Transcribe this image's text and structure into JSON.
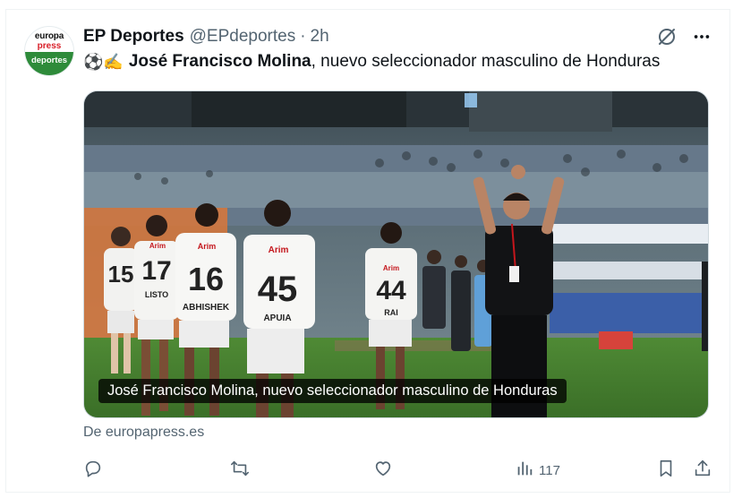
{
  "tweet": {
    "author_name": "EP Deportes",
    "handle": "@EPdeportes",
    "separator": "·",
    "time": "2h",
    "emojis": "⚽✍️",
    "text_bold": "José Francisco Molina",
    "text_rest": ", nuevo seleccionador masculino de Honduras",
    "media_caption": "José Francisco Molina, nuevo seleccionador masculino de Honduras",
    "source": "De europapress.es",
    "views": "117"
  },
  "avatar": {
    "line1": "europa",
    "line2": "press",
    "line3": "deportes"
  },
  "photo": {
    "jerseys": [
      {
        "number": "15",
        "name": ""
      },
      {
        "number": "17",
        "name": "LISTO"
      },
      {
        "number": "16",
        "name": "ABHISHEK"
      },
      {
        "number": "45",
        "name": "APUIA"
      },
      {
        "number": "44",
        "name": "RAI"
      }
    ],
    "sponsor": "Arim"
  },
  "icons": {
    "grok": "grok-icon",
    "more": "more-icon",
    "reply": "reply-icon",
    "retweet": "retweet-icon",
    "like": "like-icon",
    "views": "views-icon",
    "bookmark": "bookmark-icon",
    "share": "share-icon"
  },
  "colors": {
    "text": "#0f1419",
    "secondary": "#536471",
    "brand_green": "#2e8b3a",
    "brand_red": "#d81e28"
  }
}
